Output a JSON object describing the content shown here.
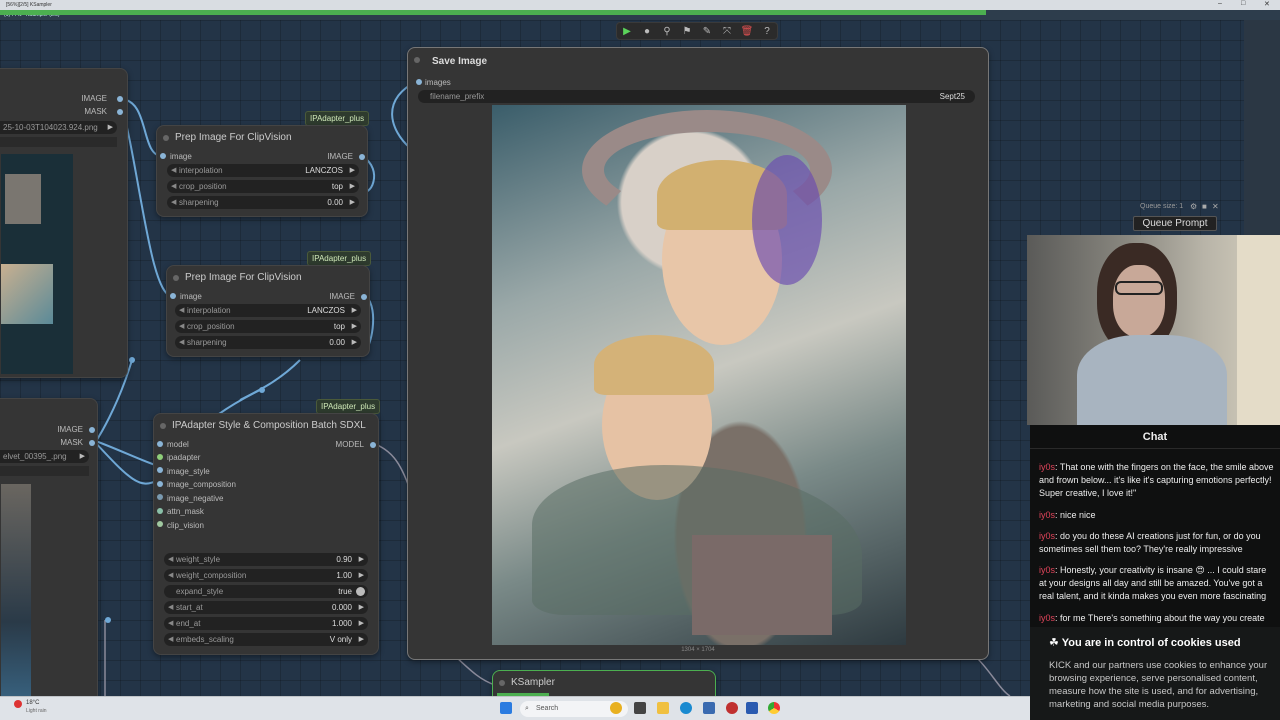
{
  "window": {
    "title": "[56%][2/5] KSampler",
    "subtitle": "(1) 77% - KSampler (2/5)",
    "progress": 0.77
  },
  "toolbar": {
    "icons": [
      "play-icon",
      "record-icon",
      "wand-icon",
      "pin-icon",
      "pencil-icon",
      "bypass-icon",
      "trash-icon",
      "help-icon"
    ]
  },
  "nodes": {
    "left_top": {
      "outputs": [
        "IMAGE",
        "MASK"
      ],
      "filename": "25-10-03T104023.924.png"
    },
    "left_bottom": {
      "outputs": [
        "IMAGE",
        "MASK"
      ],
      "filename": "elvet_00395_.png"
    },
    "prep1": {
      "badge": "IPAdapter_plus",
      "title": "Prep Image For ClipVision",
      "input": "image",
      "output": "IMAGE",
      "widgets": [
        {
          "label": "interpolation",
          "value": "LANCZOS"
        },
        {
          "label": "crop_position",
          "value": "top"
        },
        {
          "label": "sharpening",
          "value": "0.00"
        }
      ]
    },
    "prep2": {
      "badge": "IPAdapter_plus",
      "title": "Prep Image For ClipVision",
      "input": "image",
      "output": "IMAGE",
      "widgets": [
        {
          "label": "interpolation",
          "value": "LANCZOS"
        },
        {
          "label": "crop_position",
          "value": "top"
        },
        {
          "label": "sharpening",
          "value": "0.00"
        }
      ]
    },
    "ipadapter": {
      "badge": "IPAdapter_plus",
      "title": "IPAdapter Style & Composition Batch SDXL",
      "inputs": [
        "model",
        "ipadapter",
        "image_style",
        "image_composition",
        "image_negative",
        "attn_mask",
        "clip_vision"
      ],
      "output": "MODEL",
      "widgets": [
        {
          "label": "weight_style",
          "value": "0.90"
        },
        {
          "label": "weight_composition",
          "value": "1.00"
        },
        {
          "label": "expand_style",
          "value": "true"
        },
        {
          "label": "start_at",
          "value": "0.000"
        },
        {
          "label": "end_at",
          "value": "1.000"
        },
        {
          "label": "embeds_scaling",
          "value": "V only"
        }
      ]
    },
    "save": {
      "title": "Save Image",
      "input": "images",
      "prefix_label": "filename_prefix",
      "prefix_value": "Sept25",
      "dims": "1304 × 1704"
    },
    "ksampler": {
      "title": "KSampler"
    }
  },
  "queue": {
    "size_label": "Queue size: 1",
    "button": "Queue Prompt"
  },
  "chat": {
    "title": "Chat",
    "messages": [
      {
        "user": "iy0s",
        "text": ": That one with the fingers on the face, the smile above and frown below... it's like it's capturing emotions perfectly! Super creative, I love it!\""
      },
      {
        "user": "iy0s",
        "text": ": nice nice"
      },
      {
        "user": "iy0s",
        "text": ": do you do these AI creations just for fun, or do you sometimes sell them too? They're really impressive"
      },
      {
        "user": "iy0s",
        "text": ": Honestly, your creativity is insane 😍 ... I could stare at your designs all day and still be amazed. You've got a real talent, and it kinda makes you even more fascinating"
      },
      {
        "user": "iy0s",
        "text": ": for me There's something about the way you create"
      }
    ],
    "cookie_title": "You are in control of cookies used",
    "cookie_text": "KICK and our partners use cookies to enhance your browsing experience, serve personalised content, measure how the site is used, and for advertising, marketing and social media purposes."
  },
  "taskbar": {
    "weather_temp": "18°C",
    "weather_desc": "Light rain",
    "search_placeholder": "Search"
  }
}
